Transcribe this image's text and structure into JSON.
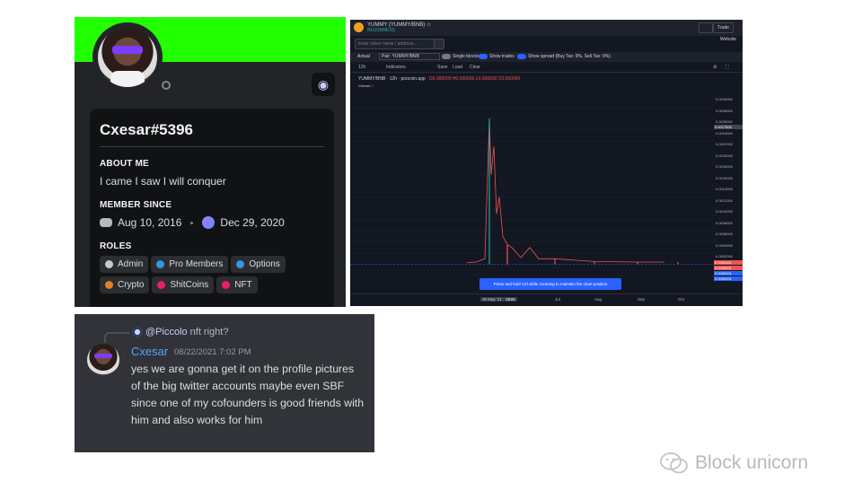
{
  "profile": {
    "username": "Cxesar#5396",
    "about_heading": "ABOUT ME",
    "about_text": "I came I saw I will conquer",
    "member_since_heading": "MEMBER SINCE",
    "discord_date": "Aug 10, 2016",
    "server_date": "Dec 29, 2020",
    "roles_heading": "ROLES",
    "roles": [
      {
        "label": "Admin",
        "color": "#c4c9ce"
      },
      {
        "label": "Pro Members",
        "color": "#3498db"
      },
      {
        "label": "Options",
        "color": "#3498db"
      },
      {
        "label": "Crypto",
        "color": "#e67e22"
      },
      {
        "label": "ShitCoins",
        "color": "#e91e63"
      },
      {
        "label": "NFT",
        "color": "#e91e63"
      }
    ],
    "banner_color": "#22ff00",
    "status": "offline"
  },
  "chart": {
    "pair_title": "YUMMY (YUMMY/BNB) ☆",
    "pair_sub": "BEUSBMESS",
    "trade_label": "Trade",
    "website_label": "Website",
    "search_placeholder": "Enter token name / address...",
    "actual_label": "Actual",
    "pair_select": "Pair: YUMMY/BNB",
    "single_blocks_label": "Single blocks",
    "show_trades_label": "Show trades",
    "show_spread_label": "Show spread (Buy Tax: 9%, Sell Tax: 9%)",
    "toolbar": [
      "12h",
      "Indicators",
      "Save",
      "Load",
      "Clear"
    ],
    "legend_pair": "YUMMY/BNB · 12h · poocoin.app",
    "legend_values": "O0.000000 H0.000000 L0.000000 C0.000000",
    "volume_label": "Volume",
    "volume_value": "0",
    "y_ticks": [
      "0.0030000",
      "0.0028000",
      "0.0026000",
      "0.0024000",
      "0.0022000",
      "0.0020000",
      "0.0018000",
      "0.0016000",
      "0.0014000",
      "0.0012000",
      "0.0010000",
      "0.0008000",
      "0.0006000",
      "0.0004000",
      "0.0002000",
      "0.0000000",
      "-0.0002000"
    ],
    "y_tag_top": "0.0017500",
    "price_tags": [
      "0.0000001",
      "0.0000001",
      "0.0000001",
      "0.0000001"
    ],
    "tooltip": "Press and hold Ctrl while zooming to maintain the chart position",
    "x_labels": [
      "30 May '21",
      "Jun",
      "Jul",
      "Aug",
      "Sep",
      "Oct"
    ],
    "x_cursor": "30 May '21 · 08:00"
  },
  "chart_data": {
    "type": "line",
    "title": "YUMMY/BNB",
    "x": [
      "May",
      "Jun",
      "Jul",
      "Aug",
      "Sep",
      "Oct"
    ],
    "series": [
      {
        "name": "YUMMY/BNB",
        "values": [
          0.0026,
          0.00035,
          0.0001,
          5e-05,
          4e-05,
          4e-05
        ]
      }
    ],
    "ylim": [
      -0.0002,
      0.0032
    ]
  },
  "chat": {
    "reply_mention": "@Piccolo",
    "reply_text": "nft right?",
    "author": "Cxesar",
    "timestamp": "08/22/2021 7:02 PM",
    "message": "yes we are gonna get it on the profile pictures of the big twitter accounts maybe even SBF since one of my cofounders is good friends with him and also works for him"
  },
  "watermark": {
    "text": "Block unicorn"
  }
}
